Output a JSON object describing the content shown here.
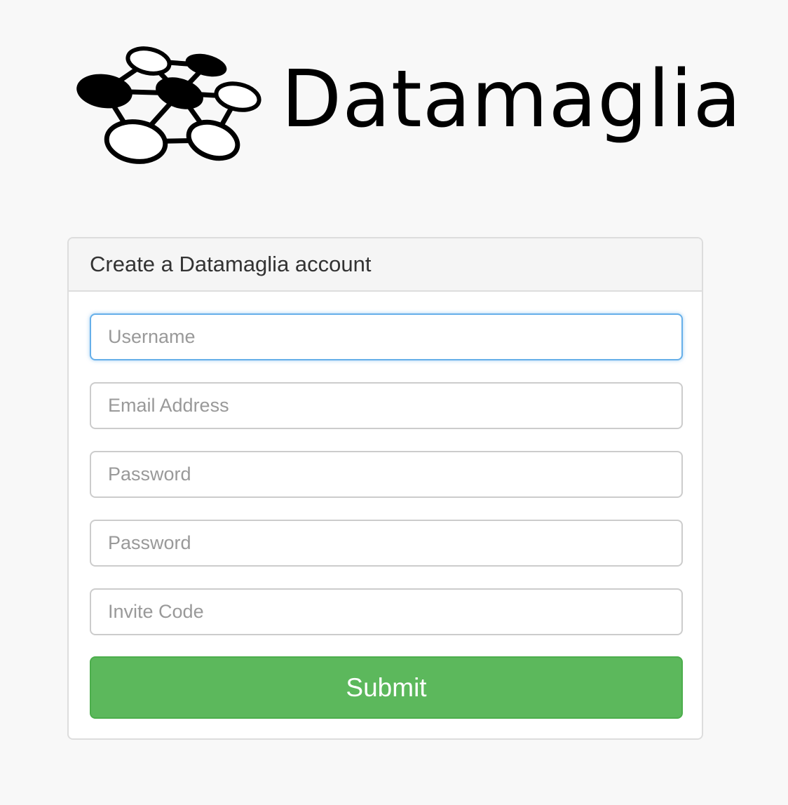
{
  "brand": {
    "name": "Datamaglia",
    "logo_icon": "network-graph-icon"
  },
  "form": {
    "heading": "Create a Datamaglia account",
    "fields": {
      "username": {
        "placeholder": "Username",
        "value": ""
      },
      "email": {
        "placeholder": "Email Address",
        "value": ""
      },
      "password": {
        "placeholder": "Password",
        "value": ""
      },
      "password_confirm": {
        "placeholder": "Password",
        "value": ""
      },
      "invite_code": {
        "placeholder": "Invite Code",
        "value": ""
      }
    },
    "submit_label": "Submit"
  },
  "colors": {
    "background": "#f8f8f8",
    "submit": "#5cb85c",
    "focus_border": "#66afe9"
  }
}
